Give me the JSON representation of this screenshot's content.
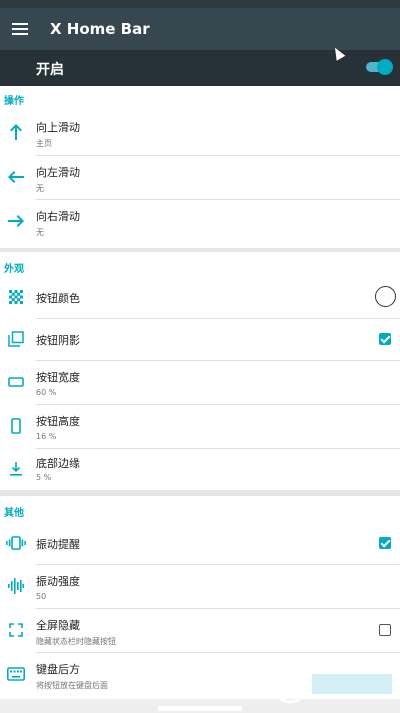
{
  "app_bar": {
    "title": "X Home Bar"
  },
  "master_switch": {
    "label": "开启",
    "enabled": true
  },
  "sections": {
    "actions": {
      "header": "操作",
      "items": [
        {
          "title": "向上滑动",
          "subtitle": "主页"
        },
        {
          "title": "向左滑动",
          "subtitle": "无"
        },
        {
          "title": "向右滑动",
          "subtitle": "无"
        }
      ]
    },
    "appearance": {
      "header": "外观",
      "items": [
        {
          "title": "按钮颜色",
          "control": "color-circle"
        },
        {
          "title": "按钮阴影",
          "control": "checkbox",
          "checked": true
        },
        {
          "title": "按钮宽度",
          "subtitle": "60 %"
        },
        {
          "title": "按钮高度",
          "subtitle": "16 %"
        },
        {
          "title": "底部边缘",
          "subtitle": "5 %"
        }
      ]
    },
    "other": {
      "header": "其他",
      "items": [
        {
          "title": "振动提醒",
          "control": "checkbox",
          "checked": true
        },
        {
          "title": "振动强度",
          "subtitle": "50"
        },
        {
          "title": "全屏隐藏",
          "subtitle": "隐藏状态栏时隐藏按钮",
          "control": "checkbox",
          "checked": false
        },
        {
          "title": "键盘后方",
          "subtitle": "将按钮放在键盘后面"
        }
      ]
    }
  },
  "colors": {
    "accent": "#00acc1",
    "app_bar": "#37474f",
    "switch_bar": "#263238"
  },
  "icons": [
    "menu-icon",
    "arrow-up-icon",
    "arrow-left-icon",
    "arrow-right-icon",
    "color-palette-icon",
    "shadow-icon",
    "width-icon",
    "height-icon",
    "bottom-margin-icon",
    "vibrate-icon",
    "vibration-strength-icon",
    "fullscreen-icon",
    "keyboard-icon"
  ]
}
